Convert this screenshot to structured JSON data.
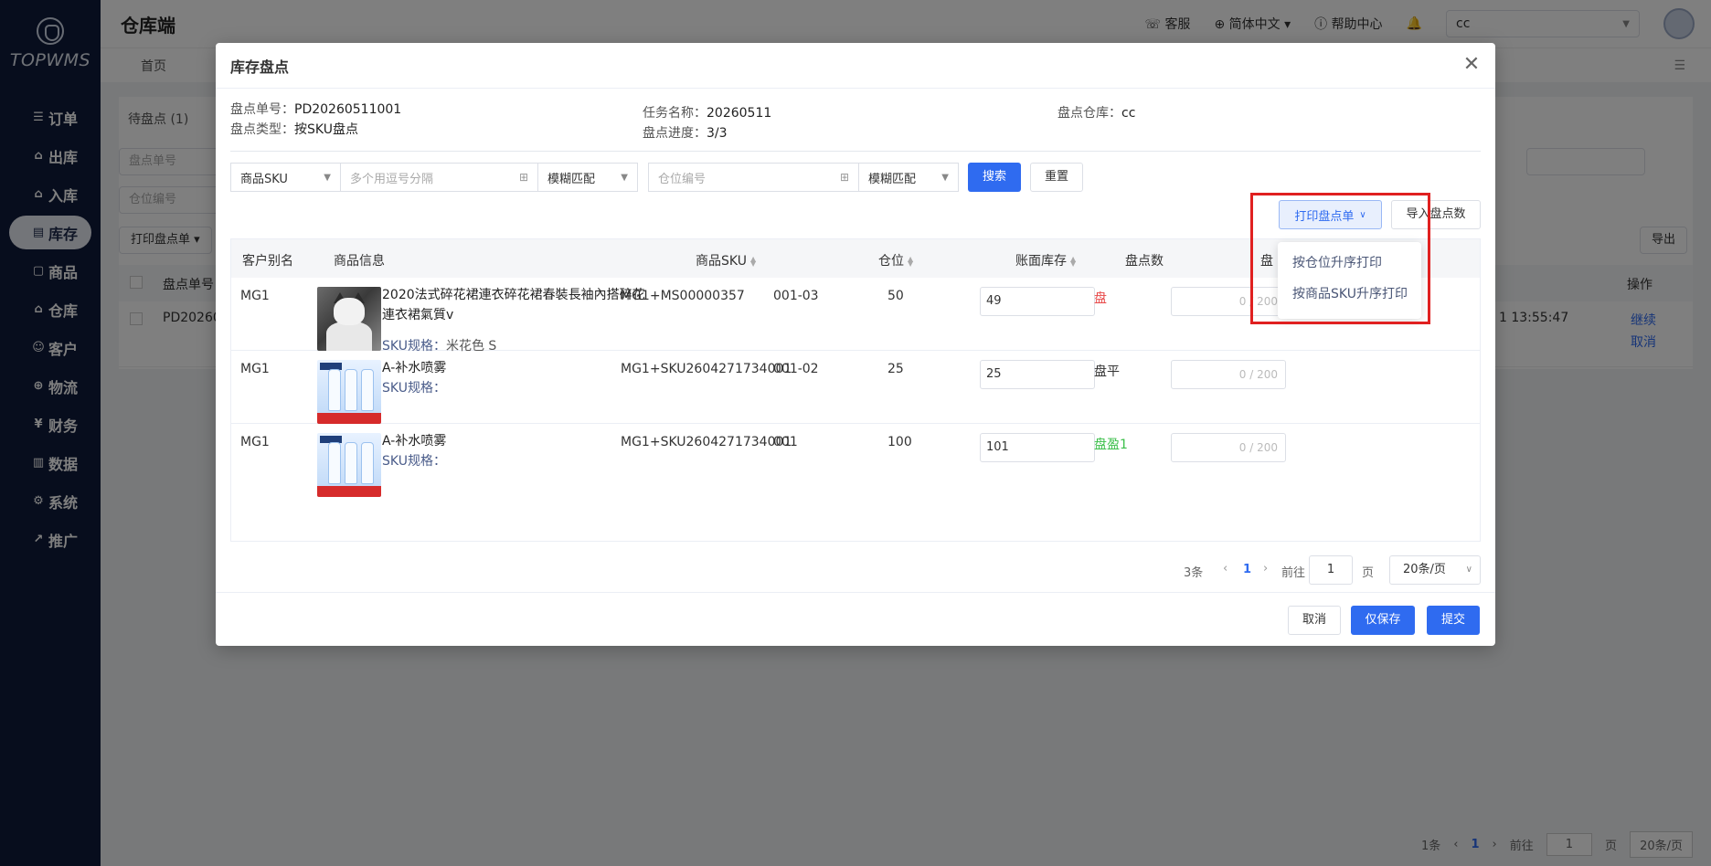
{
  "sidebar": {
    "logo_text": "TOPWMS",
    "items": [
      {
        "label": "订单",
        "icon": "order-icon",
        "glyph": "☰",
        "active": false
      },
      {
        "label": "出库",
        "icon": "outbound-icon",
        "glyph": "⌂",
        "active": false
      },
      {
        "label": "入库",
        "icon": "inbound-icon",
        "glyph": "⌂",
        "active": false
      },
      {
        "label": "库存",
        "icon": "inventory-icon",
        "glyph": "▤",
        "active": true
      },
      {
        "label": "商品",
        "icon": "goods-icon",
        "glyph": "▢",
        "active": false
      },
      {
        "label": "仓库",
        "icon": "warehouse-icon",
        "glyph": "⌂",
        "active": false
      },
      {
        "label": "客户",
        "icon": "customer-icon",
        "glyph": "☺",
        "active": false
      },
      {
        "label": "物流",
        "icon": "logistics-icon",
        "glyph": "⊕",
        "active": false
      },
      {
        "label": "财务",
        "icon": "finance-icon",
        "glyph": "¥",
        "active": false
      },
      {
        "label": "数据",
        "icon": "data-icon",
        "glyph": "▥",
        "active": false
      },
      {
        "label": "系统",
        "icon": "settings-icon",
        "glyph": "⚙",
        "active": false
      },
      {
        "label": "推广",
        "icon": "promotion-icon",
        "glyph": "↗",
        "active": false
      }
    ]
  },
  "header": {
    "title": "仓库端",
    "service": "客服",
    "language": "简体中文",
    "help": "帮助中心",
    "warehouse_value": "cc"
  },
  "tabs": {
    "home": "首页"
  },
  "background": {
    "tab_pending": "待盘点 (1)",
    "filter_order_no": "盘点单号",
    "filter_location": "仓位编号",
    "btn_print": "打印盘点单",
    "btn_export": "导出",
    "col_order_no": "盘点单号",
    "col_action": "操作",
    "row_order_no": "PD20260",
    "row_time": "1 13:55:47",
    "row_continue": "继续",
    "row_cancel": "取消",
    "pager_total": "1条",
    "pager_current": "1",
    "pager_goto": "前往",
    "pager_goto_value": "1",
    "pager_page": "页",
    "pager_size": "20条/页"
  },
  "modal": {
    "title": "库存盘点",
    "info": {
      "order_no_label": "盘点单号：",
      "order_no": "PD20260511001",
      "type_label": "盘点类型：",
      "type": "按SKU盘点",
      "task_label": "任务名称：",
      "task": "20260511",
      "progress_label": "盘点进度：",
      "progress": "3/3",
      "warehouse_label": "盘点仓库：",
      "warehouse": "cc"
    },
    "filters": {
      "sku_type": "商品SKU",
      "sku_placeholder": "多个用逗号分隔",
      "match1": "模糊匹配",
      "location_placeholder": "仓位编号",
      "match2": "模糊匹配",
      "search": "搜索",
      "reset": "重置"
    },
    "print_button": "打印盘点单",
    "import_button": "导入盘点数",
    "print_menu": [
      "按仓位升序打印",
      "按商品SKU升序打印"
    ],
    "table": {
      "columns": [
        "客户别名",
        "商品信息",
        "商品SKU",
        "仓位",
        "账面库存",
        "盘点数",
        "盘"
      ],
      "rows": [
        {
          "alias": "MG1",
          "name_line1": "2020法式碎花裙連衣碎花裙春裝長袖內搭碎花",
          "name_line2": "連衣裙氣質v",
          "spec_label": "SKU规格：",
          "spec": "米花色 S",
          "sku": "MG1+MS00000357",
          "location": "001-03",
          "book": "50",
          "count": "49",
          "result": "盘",
          "result_color": "#e84848",
          "remark": "0 / 200",
          "thumb": "cat"
        },
        {
          "alias": "MG1",
          "name_line1": "A-补水喷雾",
          "name_line2": "",
          "spec_label": "SKU规格：",
          "spec": "",
          "sku": "MG1+SKU2604271734001",
          "location": "001-02",
          "book": "25",
          "count": "25",
          "result": "盘平",
          "result_color": "#333333",
          "remark": "0 / 200",
          "thumb": "spray"
        },
        {
          "alias": "MG1",
          "name_line1": "A-补水喷雾",
          "name_line2": "",
          "spec_label": "SKU规格：",
          "spec": "",
          "sku": "MG1+SKU2604271734001",
          "location": "001",
          "book": "100",
          "count": "101",
          "result": "盘盈1",
          "result_color": "#3bbf4a",
          "remark": "0 / 200",
          "thumb": "spray"
        }
      ]
    },
    "pager": {
      "total": "3条",
      "current": "1",
      "goto": "前往",
      "goto_value": "1",
      "page": "页",
      "size": "20条/页"
    },
    "footer": {
      "cancel": "取消",
      "save_only": "仅保存",
      "submit": "提交"
    }
  }
}
